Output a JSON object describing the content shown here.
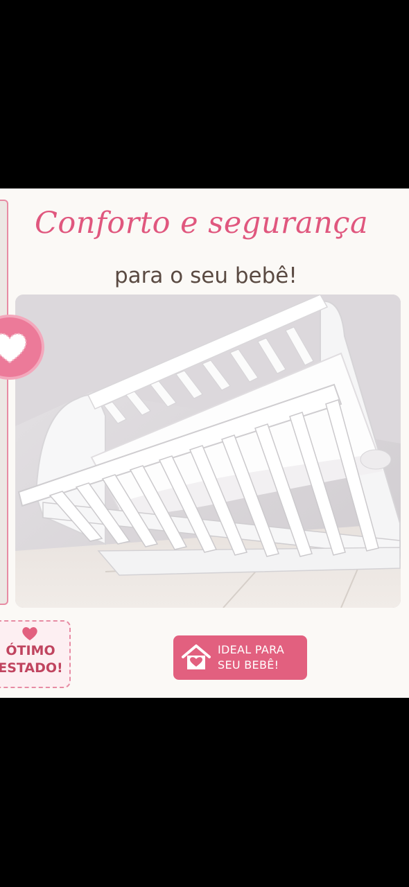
{
  "headline": "Conforto e segurança",
  "subheadline": "para o seu bebê!",
  "badges": {
    "condition_line1": "ÓTIMO",
    "condition_line2": "ESTADO!",
    "ideal_line1": "IDEAL PARA",
    "ideal_line2": "SEU BEBÊ!"
  },
  "icons": {
    "heart": "heart-icon",
    "house": "house-heart-icon"
  },
  "colors": {
    "accent_pink": "#e0577e",
    "badge_pink": "#e2607f",
    "text_brown": "#5a4a42",
    "card_bg": "#fbf9f6",
    "crib_white": "#ffffff"
  }
}
